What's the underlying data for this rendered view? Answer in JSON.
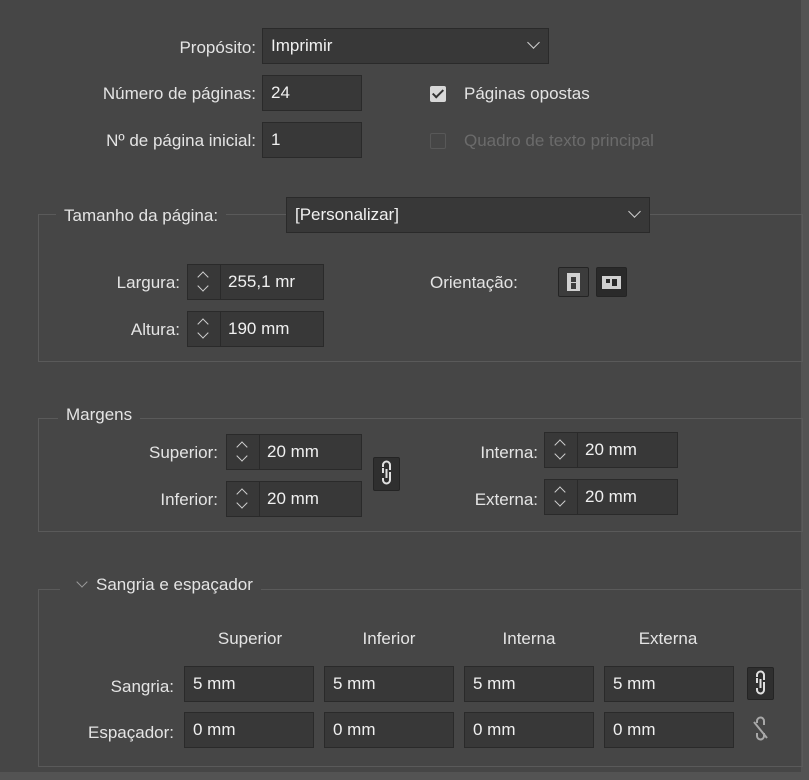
{
  "document": {
    "purpose_label": "Propósito:",
    "purpose_value": "Imprimir",
    "pages_label": "Número de páginas:",
    "pages_value": "24",
    "start_page_label": "Nº de página inicial:",
    "start_page_value": "1",
    "facing_pages_label": "Páginas opostas",
    "facing_pages_checked": true,
    "primary_text_frame_label": "Quadro de texto principal",
    "primary_text_frame_checked": false
  },
  "page_size": {
    "title": "Tamanho da página:",
    "preset_value": "[Personalizar]",
    "width_label": "Largura:",
    "width_value": "255,1 mr",
    "height_label": "Altura:",
    "height_value": "190 mm",
    "orientation_label": "Orientação:",
    "orientation_selected": "landscape"
  },
  "margins": {
    "title": "Margens",
    "top_label": "Superior:",
    "top_value": "20 mm",
    "bottom_label": "Inferior:",
    "bottom_value": "20 mm",
    "inside_label": "Interna:",
    "inside_value": "20 mm",
    "outside_label": "Externa:",
    "outside_value": "20 mm"
  },
  "bleed_slug": {
    "title": "Sangria e espaçador",
    "columns": [
      "Superior",
      "Inferior",
      "Interna",
      "Externa"
    ],
    "bleed_label": "Sangria:",
    "bleed_values": [
      "5 mm",
      "5 mm",
      "5 mm",
      "5 mm"
    ],
    "slug_label": "Espaçador:",
    "slug_values": [
      "0 mm",
      "0 mm",
      "0 mm",
      "0 mm"
    ]
  }
}
